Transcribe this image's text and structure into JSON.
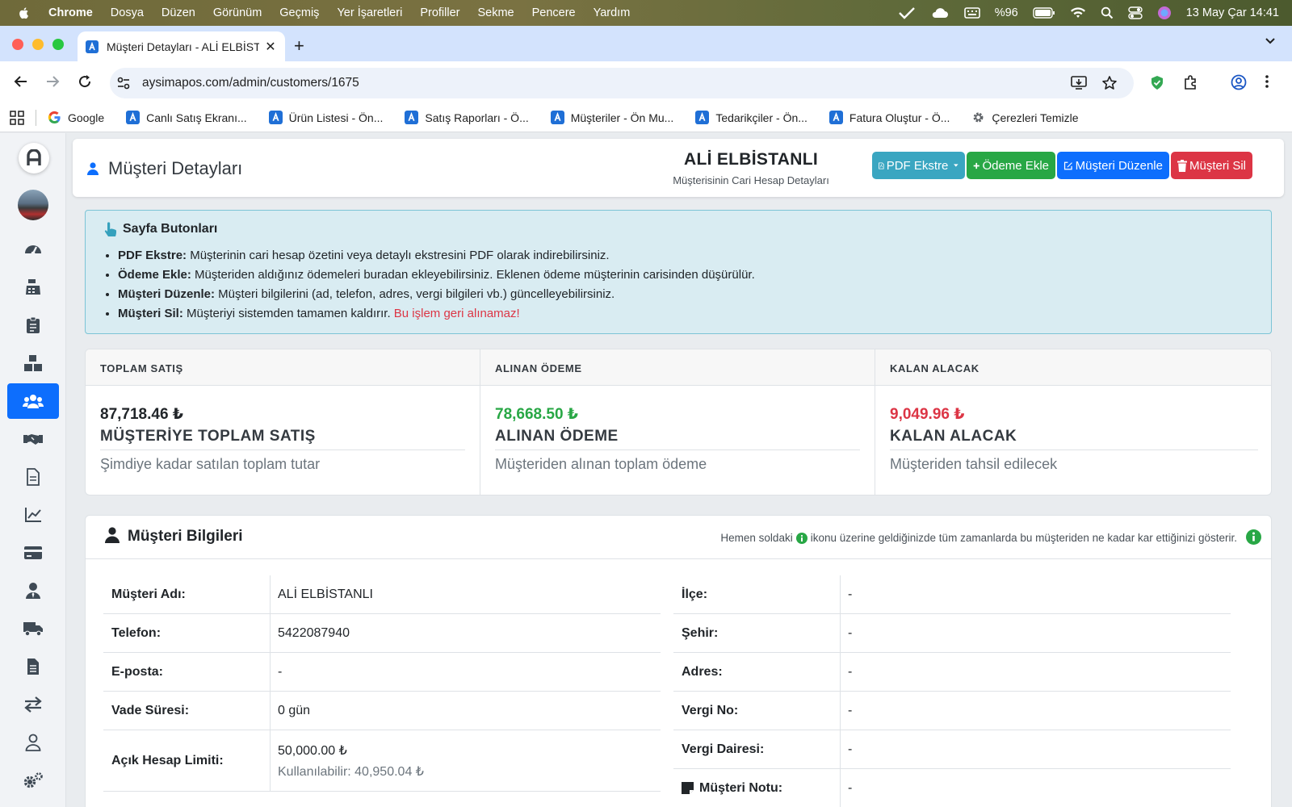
{
  "mac": {
    "menu": [
      "Chrome",
      "Dosya",
      "Düzen",
      "Görünüm",
      "Geçmiş",
      "Yer İşaretleri",
      "Profiller",
      "Sekme",
      "Pencere",
      "Yardım"
    ],
    "battery": "%96",
    "datetime": "13 May Çar  14:41"
  },
  "browser": {
    "tab_title": "Müşteri Detayları - ALİ ELBİSTANLI",
    "url_host": "aysimapos.com",
    "url_path": "/admin/customers/1675",
    "bookmarks": [
      "Google",
      "Canlı Satış Ekranı...",
      "Ürün Listesi - Ön...",
      "Satış Raporları - Ö...",
      "Müşteriler - Ön Mu...",
      "Tedarikçiler - Ön...",
      "Fatura Oluştur - Ö...",
      "Çerezleri Temizle"
    ]
  },
  "header": {
    "page_title": "Müşteri Detayları",
    "customer_name": "ALİ ELBİSTANLI",
    "customer_subtitle": "Müşterisinin Cari Hesap Detayları",
    "buttons": {
      "pdf": "PDF Ekstre",
      "payment": "Ödeme Ekle",
      "edit": "Müşteri Düzenle",
      "delete": "Müşteri Sil"
    }
  },
  "info": {
    "title": "Sayfa Butonları",
    "items": [
      {
        "label": "PDF Ekstre:",
        "text": " Müşterinin cari hesap özetini veya detaylı ekstresini PDF olarak indirebilirsiniz."
      },
      {
        "label": "Ödeme Ekle:",
        "text": " Müşteriden aldığınız ödemeleri buradan ekleyebilirsiniz. Eklenen ödeme müşterinin carisinden düşürülür."
      },
      {
        "label": "Müşteri Düzenle:",
        "text": " Müşteri bilgilerini (ad, telefon, adres, vergi bilgileri vb.) güncelleyebilirsiniz."
      },
      {
        "label": "Müşteri Sil:",
        "text": " Müşteriyi sistemden tamamen kaldırır. ",
        "warning": "Bu işlem geri alınamaz!"
      }
    ]
  },
  "stats": [
    {
      "head": "TOPLAM SATIŞ",
      "value": "87,718.46 ₺",
      "label": "MÜŞTERİYE TOPLAM SATIŞ",
      "desc": "Şimdiye kadar satılan toplam tutar",
      "color": "#212529"
    },
    {
      "head": "ALINAN ÖDEME",
      "value": "78,668.50 ₺",
      "label": "ALINAN ÖDEME",
      "desc": "Müşteriden alınan toplam ödeme",
      "color": "#28a745"
    },
    {
      "head": "KALAN ALACAK",
      "value": "9,049.96 ₺",
      "label": "KALAN ALACAK",
      "desc": "Müşteriden tahsil edilecek",
      "color": "#dc3545"
    }
  ],
  "customer": {
    "title": "Müşteri Bilgileri",
    "hint_before": "Hemen soldaki",
    "hint_after": "ikonu üzerine geldiğinizde tüm zamanlarda bu müşteriden ne kadar kar ettiğinizi gösterir.",
    "left": [
      {
        "key": "Müşteri Adı:",
        "value": "ALİ ELBİSTANLI"
      },
      {
        "key": "Telefon:",
        "value": "5422087940"
      },
      {
        "key": "E-posta:",
        "value": "-"
      },
      {
        "key": "Vade Süresi:",
        "value": "0 gün"
      },
      {
        "key": "Açık Hesap Limiti:",
        "value": "50,000.00 ₺",
        "sub": "Kullanılabilir: 40,950.04 ₺"
      }
    ],
    "right": [
      {
        "key": "İlçe:",
        "value": "-"
      },
      {
        "key": "Şehir:",
        "value": "-"
      },
      {
        "key": "Adres:",
        "value": "-"
      },
      {
        "key": "Vergi No:",
        "value": "-"
      },
      {
        "key": "Vergi Dairesi:",
        "value": "-"
      },
      {
        "key": "Müşteri Notu:",
        "value": "-"
      }
    ]
  },
  "colors": {
    "primary": "#0d6efd",
    "info_button": "#3aa6c1",
    "success": "#28a745",
    "danger": "#dc3545"
  }
}
